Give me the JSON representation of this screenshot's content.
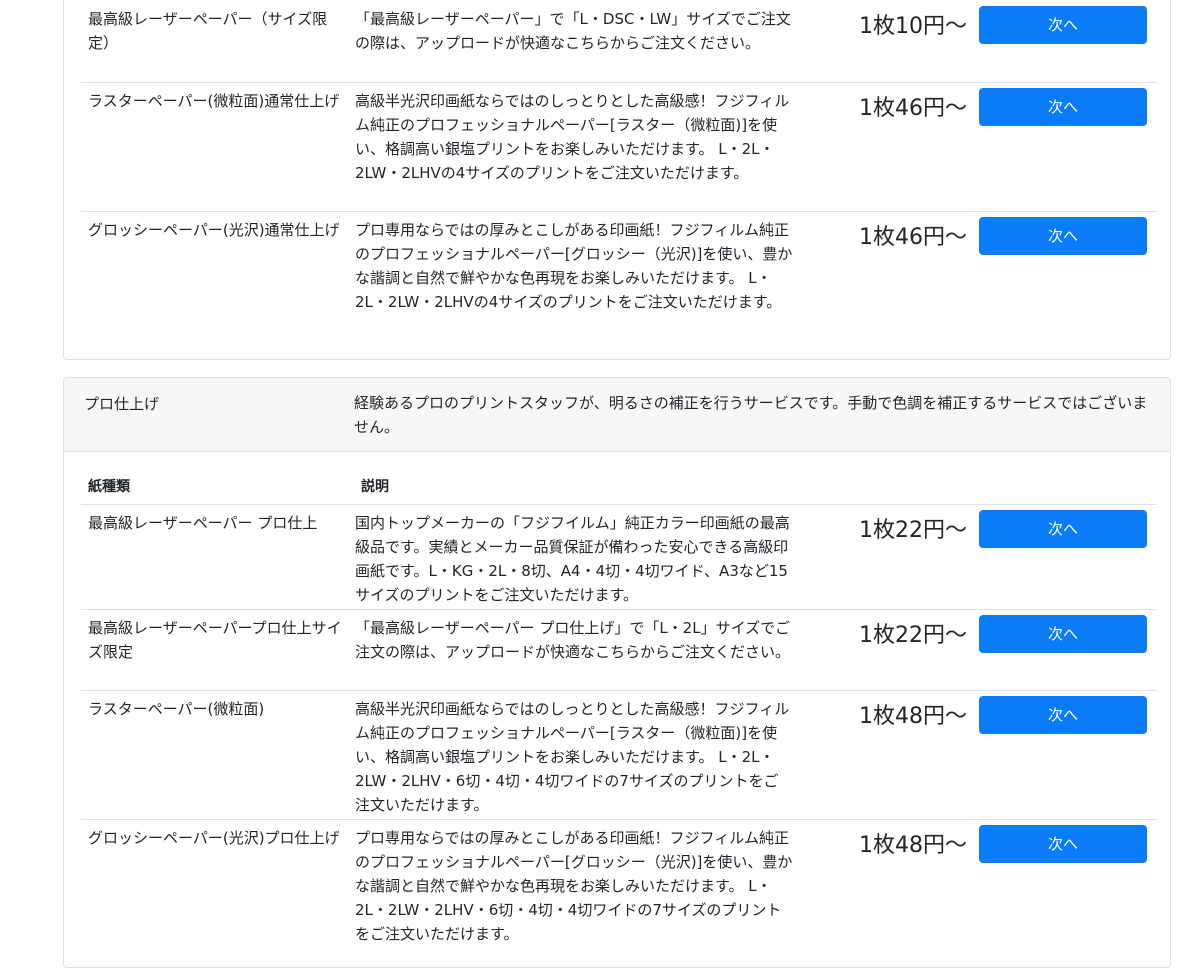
{
  "top_section": {
    "rows": [
      {
        "paper": "最高級レーザーペーパー（サイズ限定）",
        "description": "「最高級レーザーペーパー」で「L・DSC・LW」サイズでご注文の際は、アップロードが快適なこちらからご注文ください。",
        "price": "1枚10円〜",
        "button": "次へ"
      },
      {
        "paper": "ラスターペーパー(微粒面)通常仕上げ",
        "description": "高級半光沢印画紙ならではのしっとりとした高級感！フジフィルム純正のプロフェッショナルペーパー[ラスター（微粒面)]を使い、格調高い銀塩プリントをお楽しみいただけます。 L・2L・2LW・2LHVの4サイズのプリントをご注文いただけます。",
        "price": "1枚46円〜",
        "button": "次へ"
      },
      {
        "paper": "グロッシーペーパー(光沢)通常仕上げ",
        "description": "プロ専用ならではの厚みとこしがある印画紙！フジフィルム純正のプロフェッショナルペーパー[グロッシー（光沢)]を使い、豊かな諧調と自然で鮮やかな色再現をお楽しみいただけます。 L・2L・2LW・2LHVの4サイズのプリントをご注文いただけます。",
        "price": "1枚46円〜",
        "button": "次へ"
      }
    ]
  },
  "pro_section": {
    "title": "プロ仕上げ",
    "description": "経験あるプロのプリントスタッフが、明るさの補正を行うサービスです。手動で色調を補正するサービスではございません。",
    "col_paper": "紙種類",
    "col_desc": "説明",
    "rows": [
      {
        "paper": "最高級レーザーペーパー プロ仕上",
        "description": "国内トップメーカーの「フジフイルム」純正カラー印画紙の最高級品です。実績とメーカー品質保証が備わった安心できる高級印画紙です。L・KG・2L・8切、A4・4切・4切ワイド、A3など15サイズのプリントをご注文いただけます。",
        "price": "1枚22円〜",
        "button": "次へ"
      },
      {
        "paper": "最高級レーザーペーパープロ仕上サイズ限定",
        "description": "「最高級レーザーペーパー プロ仕上げ」で「L・2L」サイズでご注文の際は、アップロードが快適なこちらからご注文ください。",
        "price": "1枚22円〜",
        "button": "次へ"
      },
      {
        "paper": "ラスターペーパー(微粒面)",
        "description": "高級半光沢印画紙ならではのしっとりとした高級感！フジフィルム純正のプロフェッショナルペーパー[ラスター（微粒面)]を使い、格調高い銀塩プリントをお楽しみいただけます。 L・2L・2LW・2LHV・6切・4切・4切ワイドの7サイズのプリントをご注文いただけます。",
        "price": "1枚48円〜",
        "button": "次へ"
      },
      {
        "paper": "グロッシーペーパー(光沢)プロ仕上げ",
        "description": "プロ専用ならではの厚みとこしがある印画紙！フジフィルム純正のプロフェッショナルペーパー[グロッシー（光沢)]を使い、豊かな諧調と自然で鮮やかな色再現をお楽しみいただけます。 L・2L・2LW・2LHV・6切・4切・4切ワイドの7サイズのプリントをご注文いただけます。",
        "price": "1枚48円〜",
        "button": "次へ"
      }
    ]
  },
  "colors": {
    "button_primary": "#0b7cf7",
    "header_bg": "#f7f7f7",
    "border": "#dfdfdf"
  }
}
